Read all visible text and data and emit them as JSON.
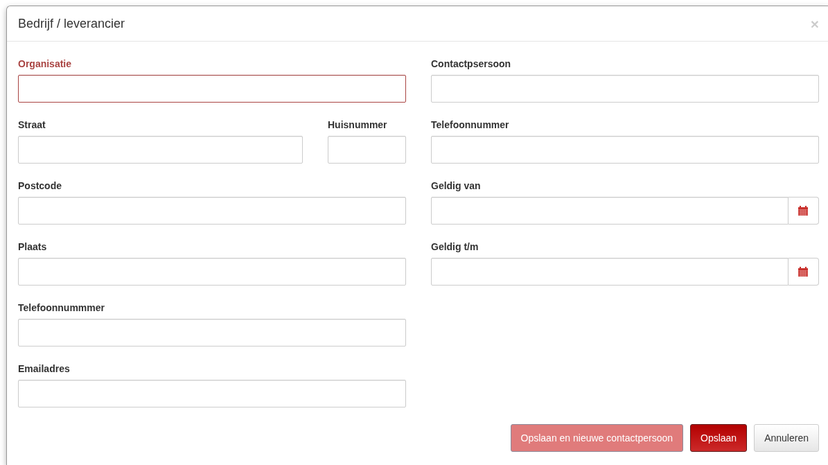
{
  "dialog": {
    "title": "Bedrijf / leverancier",
    "close": "×"
  },
  "left_column": [
    {
      "fields": [
        {
          "label": "Organisatie",
          "kind": "text",
          "error": true
        }
      ]
    },
    {
      "fields": [
        {
          "label": "Straat",
          "kind": "text",
          "error": false
        },
        {
          "label": "Huisnummer",
          "kind": "text",
          "error": false
        }
      ]
    },
    {
      "fields": [
        {
          "label": "Postcode",
          "kind": "text",
          "error": false
        }
      ]
    },
    {
      "fields": [
        {
          "label": "Plaats",
          "kind": "text",
          "error": false
        }
      ]
    },
    {
      "fields": [
        {
          "label": "Telefoonnummmer",
          "kind": "text",
          "error": false
        }
      ]
    },
    {
      "fields": [
        {
          "label": "Emailadres",
          "kind": "text",
          "error": false
        }
      ]
    }
  ],
  "right_column": [
    {
      "fields": [
        {
          "label": "Contactpsersoon",
          "kind": "text",
          "error": false
        }
      ]
    },
    {
      "fields": [
        {
          "label": "Telefoonnummer",
          "kind": "text",
          "error": false
        }
      ]
    },
    {
      "fields": [
        {
          "label": "Geldig van",
          "kind": "date",
          "error": false
        }
      ]
    },
    {
      "fields": [
        {
          "label": "Geldig t/m",
          "kind": "date",
          "error": false
        }
      ]
    }
  ],
  "buttons": [
    {
      "label": "Opslaan en nieuwe contactpersoon",
      "kind": "primary",
      "disabled": true
    },
    {
      "label": "Opslaan",
      "kind": "primary",
      "disabled": false
    },
    {
      "label": "Annuleren",
      "kind": "secondary",
      "disabled": false
    }
  ]
}
